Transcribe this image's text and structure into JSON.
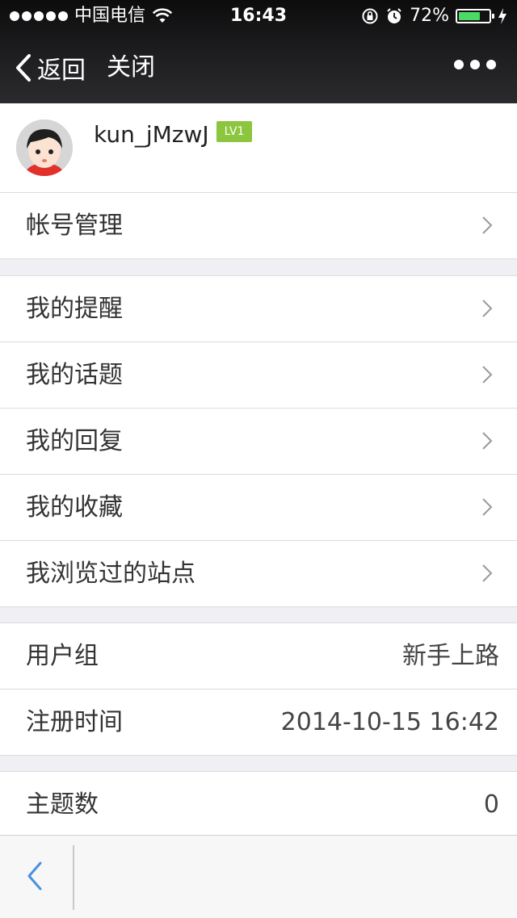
{
  "status_bar": {
    "carrier": "中国电信",
    "time": "16:43",
    "battery_percent": "72%",
    "battery_level": 0.72
  },
  "nav": {
    "back_label": "返回",
    "close_label": "关闭"
  },
  "profile": {
    "username": "kun_jMzwJ",
    "level": "LV1"
  },
  "groups": {
    "account": [
      {
        "label": "帐号管理"
      }
    ],
    "mine": [
      {
        "label": "我的提醒"
      },
      {
        "label": "我的话题"
      },
      {
        "label": "我的回复"
      },
      {
        "label": "我的收藏"
      },
      {
        "label": "我浏览过的站点"
      }
    ],
    "info": [
      {
        "label": "用户组",
        "value": "新手上路"
      },
      {
        "label": "注册时间",
        "value": "2014-10-15 16:42"
      }
    ],
    "stats": [
      {
        "label": "主题数",
        "value": "0"
      }
    ]
  },
  "colors": {
    "accent_badge": "#8cc63e",
    "toolbar_icon": "#4a90e2",
    "battery_fill": "#4cd964"
  },
  "icons": [
    "wifi-icon",
    "rotation-lock-icon",
    "alarm-icon",
    "battery-icon",
    "charging-icon",
    "back-chevron-icon",
    "more-icon",
    "chevron-right-icon"
  ]
}
